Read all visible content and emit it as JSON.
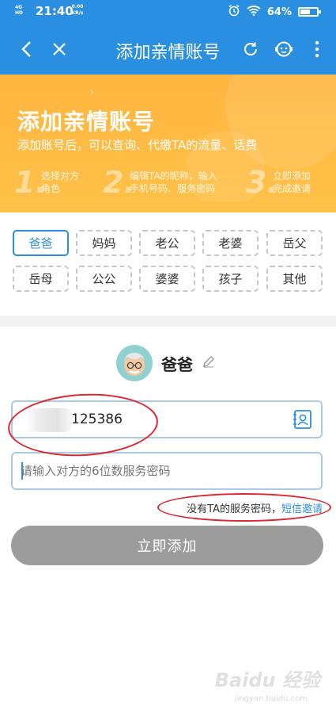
{
  "status_bar": {
    "network": "4G HD",
    "time": "21:40",
    "speed_value": "0.00",
    "speed_unit": "KB/s",
    "battery": "64%",
    "battery_level": 0.64
  },
  "nav": {
    "title": "添加亲情账号",
    "icons": [
      "back-icon",
      "close-icon",
      "refresh-icon",
      "customer-service-icon",
      "more-icon"
    ]
  },
  "banner": {
    "title": "添加亲情账号",
    "subtitle": "添加账号后，可以查询、代缴TA的流量、话费",
    "steps": [
      {
        "num": "1.",
        "line1": "选择对方",
        "line2": "角色"
      },
      {
        "num": "2.",
        "line1": "编辑TA的昵称，输入",
        "line2": "手机号码、服务密码"
      },
      {
        "num": "3.",
        "line1": "立即添加",
        "line2": "完成邀请"
      }
    ]
  },
  "relations": [
    "爸爸",
    "妈妈",
    "老公",
    "老婆",
    "岳父",
    "岳母",
    "公公",
    "婆婆",
    "孩子",
    "其他"
  ],
  "selected_relation": "爸爸",
  "profile": {
    "name": "爸爸"
  },
  "form": {
    "phone_value": "125386",
    "password_placeholder": "请输入对方的6位数服务密码",
    "hint_text": "没有TA的服务密码，",
    "hint_link": "短信邀请",
    "submit_label": "立即添加"
  },
  "watermark": {
    "text": "Baidu 经验",
    "sub": "jingyan.baidu.com"
  },
  "colors": {
    "primary": "#2a8fe0",
    "banner": "#ffb53f",
    "annotation": "#e0262f",
    "button_disabled": "#9c9c9c"
  }
}
